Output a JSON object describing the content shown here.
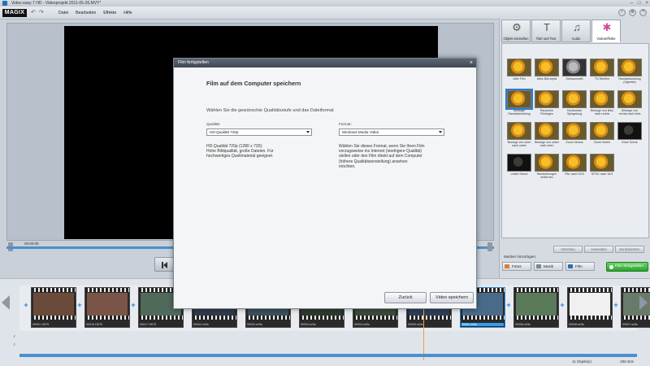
{
  "window": {
    "title": "Video easy 7 HD - Videoprojekt 2011-05-26.MVY*",
    "minimize": "–",
    "maximize": "□",
    "close": "×"
  },
  "menubar": {
    "logo": "MAGIX",
    "undo": "↶",
    "redo": "↷",
    "menus": [
      "Datei",
      "Bearbeiten",
      "Effekte",
      "Hilfe"
    ]
  },
  "preview": {
    "time": "00:00:00"
  },
  "right_panel": {
    "tabs": [
      {
        "label": "Objekt einstellen",
        "icon": "⚙",
        "icon_name": "object-settings-icon"
      },
      {
        "label": "Titel und Text",
        "icon": "T",
        "icon_name": "title-text-icon"
      },
      {
        "label": "Audio",
        "icon": "♫",
        "icon_name": "audio-wave-icon"
      },
      {
        "label": "Videoeffekte",
        "icon": "✱",
        "icon_name": "video-effects-icon"
      }
    ],
    "effects": [
      "Alter Film",
      "Altes Bild sepia",
      "Schwarzweiß",
      "TV-Streifen",
      "Randabdunklung (Vignette)",
      "Bewegte Randabdunklung",
      "Rauschen Filmfugen",
      "Horizontale Spiegelung",
      "Bewege von links nach rechts",
      "Bewege von rechts nach links",
      "Bewege von oben nach unten",
      "Bewege von unten nach oben",
      "Zoom heraus",
      "Zoom herein",
      "Erste Szene",
      "Letzte Szene",
      "Randstörungen entfernen",
      "PAL nach 16:9",
      "NTSC nach 16:9"
    ],
    "buttons": [
      "Vorschau",
      "Anwenden",
      "Zurücksetzen"
    ]
  },
  "media_add": {
    "label": "Medien hinzufügen:",
    "fotos": "Fotos",
    "musik": "Musik",
    "film": "Film",
    "finish": "Film fertigstellen"
  },
  "timeline": {
    "clips": [
      "00001 HD75",
      "00016 HD75",
      "00017 HD75",
      "00002.m2ts",
      "00003.m2ts",
      "00004.m2ts",
      "00004.m2ts",
      "00005.m2ts",
      "00001.m2ts",
      "00006.m2ts",
      "00008.m2ts",
      "00007.m2ts"
    ],
    "count": "11 Objekt(e)",
    "duration": "28m:52s"
  },
  "dialog": {
    "title": "Film fertigstellen",
    "close": "×",
    "heading": "Film auf dem Computer speichern",
    "intro": "Wählen Sie die gewünschte Qualitätsstufe und das Dateiformat",
    "quality_label": "Qualität:",
    "quality_value": "HD-Qualität 720p",
    "format_label": "Format:",
    "format_value": "Windows Media Video",
    "quality_desc": "HD-Qualität 720p (1280 x 720):\nHohe Bildqualität, große Dateien. Für\nhochwertiges Quellmaterial geeignet.",
    "format_desc": "Wählen Sie dieses Format, wenn Sie Ihren Film\nvorzugsweise ins Internet (niedrigere Qualität)\nstellen oder den Film direkt auf dem Computer\n(höhere Qualitätseinstellung) ansehen\nmöchten.",
    "back_button": "Zurück",
    "save_button": "Video speichern"
  }
}
